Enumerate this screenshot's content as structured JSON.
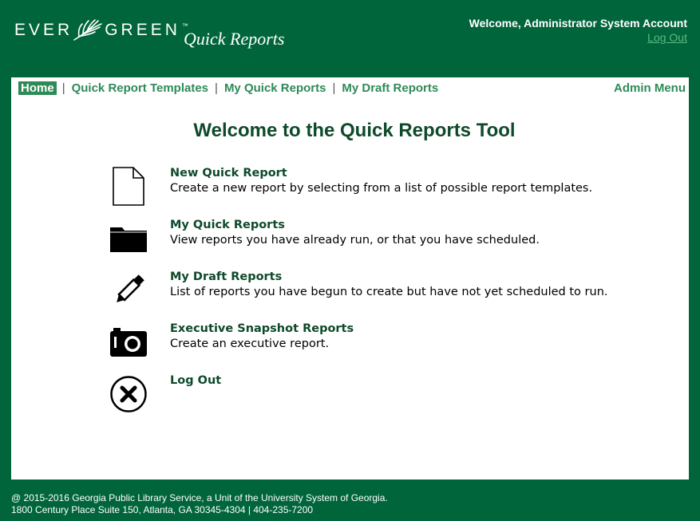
{
  "header": {
    "logo_left": "EVER",
    "logo_right": "GREEN",
    "logo_tm": "™",
    "app_title": "Quick Reports",
    "welcome": "Welcome, Administrator System Account",
    "logout_link": "Log Out"
  },
  "nav": {
    "items": [
      {
        "label": "Home",
        "active": true
      },
      {
        "label": "Quick Report Templates"
      },
      {
        "label": "My Quick Reports"
      },
      {
        "label": "My Draft Reports"
      }
    ],
    "separator": "|",
    "admin_menu": "Admin Menu"
  },
  "main": {
    "heading": "Welcome to the Quick Reports Tool",
    "items": [
      {
        "title": "New Quick Report",
        "desc": "Create a new report by selecting from a list of possible report templates.",
        "icon": "document-icon"
      },
      {
        "title": "My Quick Reports",
        "desc": "View reports you have already run, or that you have scheduled.",
        "icon": "folder-icon"
      },
      {
        "title": "My Draft Reports",
        "desc": "List of reports you have begun to create but have not yet scheduled to run.",
        "icon": "pencil-icon"
      },
      {
        "title": "Executive Snapshot Reports",
        "desc": "Create an executive report.",
        "icon": "camera-icon"
      },
      {
        "title": "Log Out",
        "desc": "",
        "icon": "close-circle-icon"
      }
    ]
  },
  "footer": {
    "line1": "@ 2015-2016 Georgia Public Library Service, a Unit of the University System of Georgia.",
    "line2": "1800 Century Place Suite 150, Atlanta, GA 30345-4304 | 404-235-7200"
  },
  "colors": {
    "background": "#00653a",
    "link_green": "#2e8a57",
    "heading_green": "#0e4a2a"
  }
}
